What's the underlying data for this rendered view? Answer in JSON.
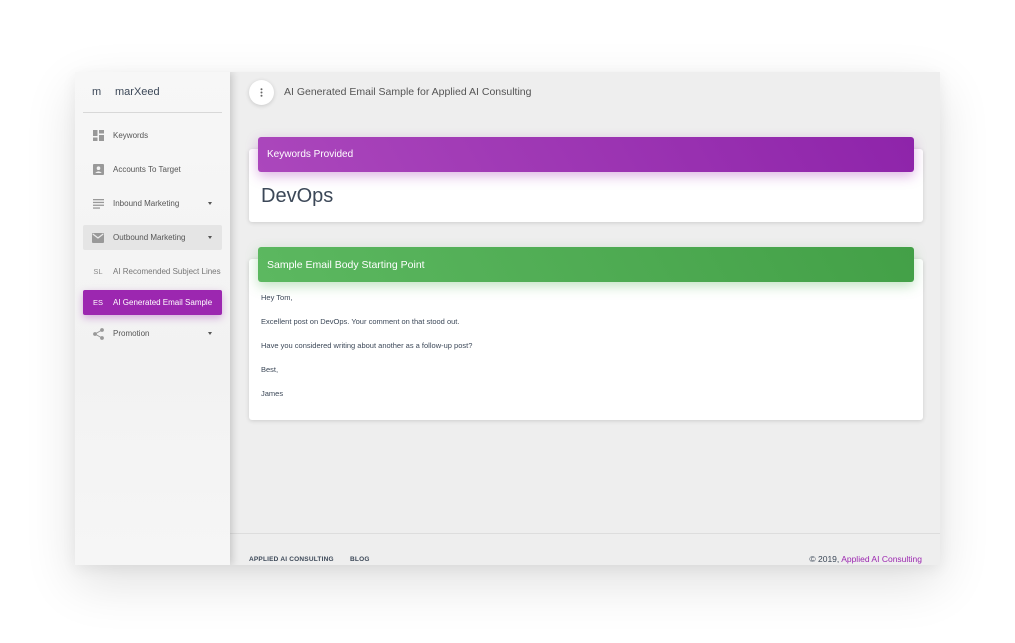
{
  "brand": {
    "mini": "m",
    "name": "marXeed"
  },
  "sidebar": {
    "items": [
      {
        "label": "Keywords",
        "icon": "dashboard-icon"
      },
      {
        "label": "Accounts To Target",
        "icon": "contact-card-icon"
      },
      {
        "label": "Inbound Marketing",
        "icon": "notes-icon"
      },
      {
        "label": "Outbound Marketing",
        "icon": "mail-icon"
      },
      {
        "label": "AI Recomended Subject Lines",
        "abbr": "SL"
      },
      {
        "label": "AI Generated Email Sample",
        "abbr": "ES"
      },
      {
        "label": "Promotion",
        "icon": "share-icon"
      }
    ]
  },
  "header": {
    "title": "AI Generated Email Sample for Applied AI Consulting"
  },
  "keywords_card": {
    "title": "Keywords Provided",
    "value": "DevOps"
  },
  "email_card": {
    "title": "Sample Email Body Starting Point",
    "lines": [
      "Hey Tom,",
      "Excellent post on DevOps. Your comment on that stood out.",
      "Have you considered writing about another as a follow-up post?",
      "Best,",
      "James"
    ]
  },
  "footer": {
    "links": [
      "APPLIED AI CONSULTING",
      "BLOG"
    ],
    "copyright_prefix": "© 2019,",
    "copyright_link": "Applied AI Consulting"
  },
  "colors": {
    "accent_purple": "#9c27b0",
    "accent_green": "#4caf50",
    "background": "#eeeeee"
  }
}
